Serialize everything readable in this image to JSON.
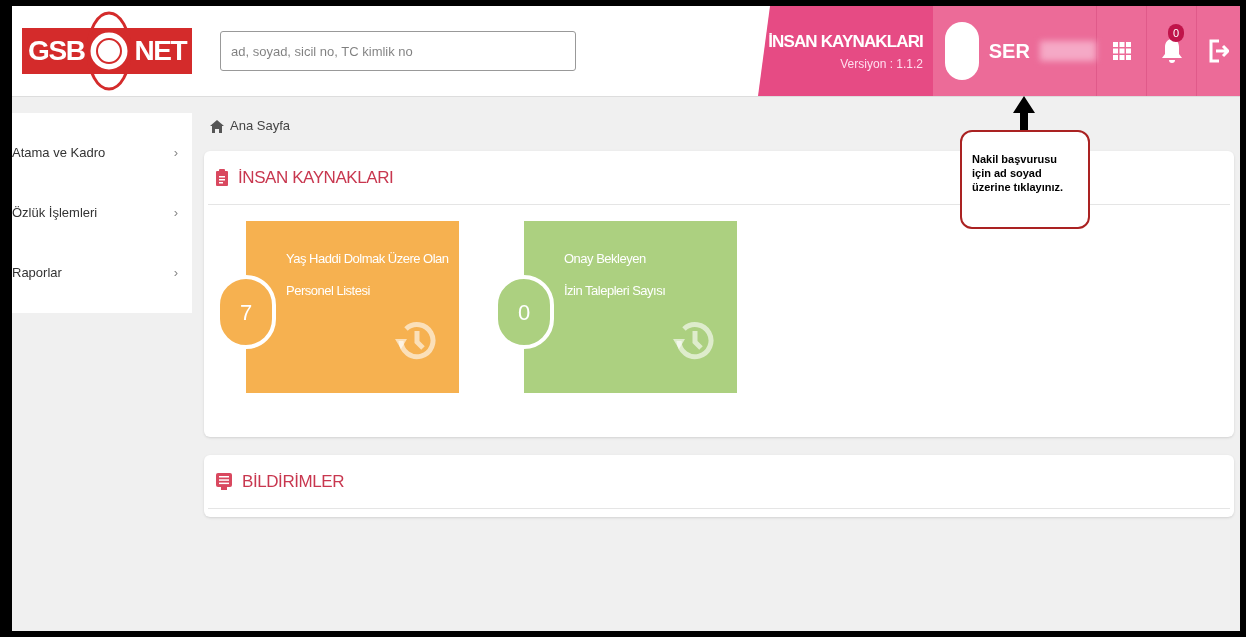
{
  "header": {
    "logo": {
      "left": "GSB",
      "right": "NET"
    },
    "search": {
      "placeholder": "ad, soyad, sicil no, TC kimlik no"
    },
    "module": {
      "title": "İNSAN KAYNAKLARI",
      "version": "Versiyon : 1.1.2"
    },
    "user": {
      "name": "SER"
    },
    "notifications": {
      "count": "0"
    }
  },
  "sidebar": {
    "items": [
      {
        "label": "Atama ve Kadro",
        "chevron": "›"
      },
      {
        "label": "Özlük İşlemleri",
        "chevron": "›"
      },
      {
        "label": "Raporlar",
        "chevron": "›"
      }
    ]
  },
  "breadcrumb": "Ana Sayfa",
  "panels": [
    {
      "kind": "tiles",
      "title": "İNSAN KAYNAKLARI",
      "tiles": [
        {
          "count": "7",
          "lines": [
            "Yaş Haddi Dolmak Üzere Olan",
            "Personel Listesi"
          ],
          "color": "#f6b150"
        },
        {
          "count": "0",
          "lines": [
            "Onay Bekleyen",
            "İzin Talepleri Sayısı"
          ],
          "color": "#acd080"
        }
      ]
    },
    {
      "kind": "list",
      "title": "BİLDİRİMLER"
    }
  ],
  "callout": {
    "text": "Nakil başvurusu için ad soyad üzerine tıklayınız."
  }
}
